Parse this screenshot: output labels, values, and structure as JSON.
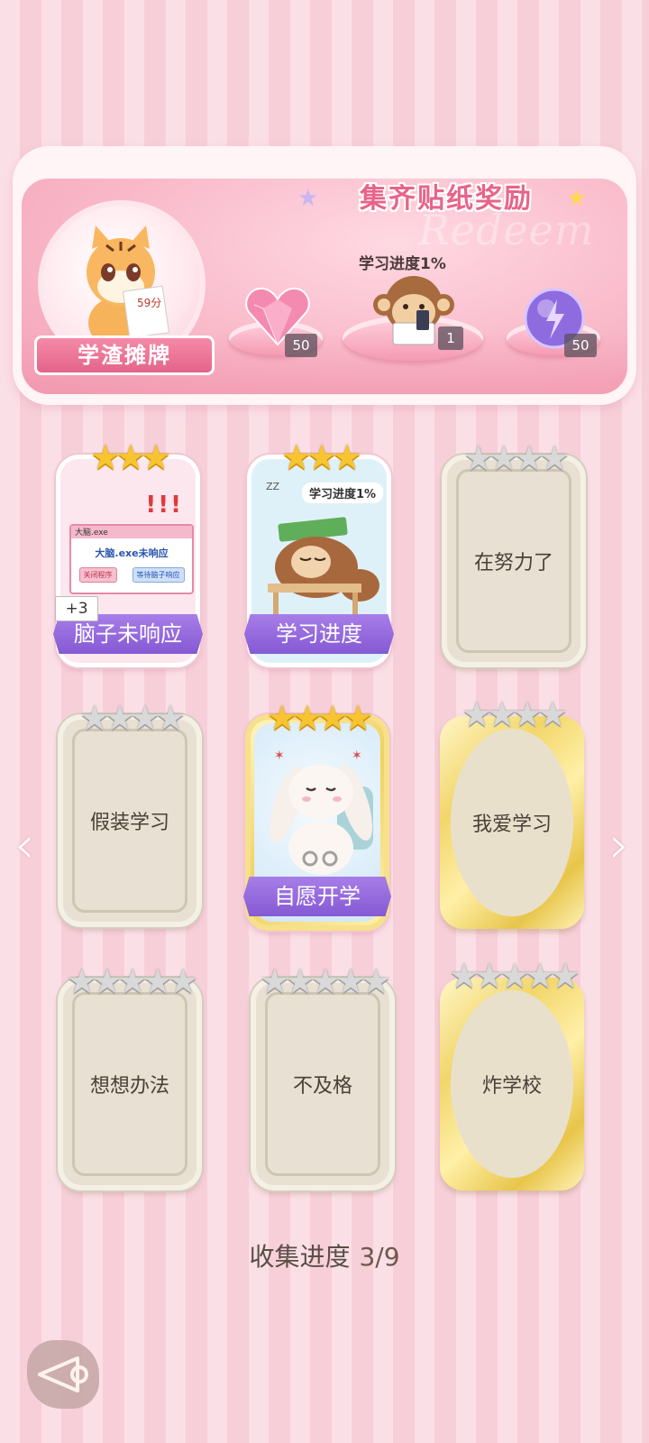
{
  "banner": {
    "title": "集齐贴纸奖励",
    "bg_word": "Redeem",
    "avatar_label": "学渣摊牌",
    "avatar_score": "59分",
    "rewards": [
      {
        "icon": "heart-gem-icon",
        "count": "50"
      },
      {
        "icon": "monkey-sticker-icon",
        "label": "学习进度1%",
        "count": "1"
      },
      {
        "icon": "lightning-orb-icon",
        "count": "50"
      }
    ]
  },
  "cards": [
    {
      "name": "脑子未响应",
      "stars": 3,
      "max_stars": 3,
      "unlocked": true,
      "badge": "+3",
      "art": {
        "window_title": "大脑.exe",
        "message": "大脑.exe未响应",
        "btn1": "关闭程序",
        "btn2": "等待脑子响应"
      }
    },
    {
      "name": "学习进度",
      "stars": 3,
      "max_stars": 3,
      "unlocked": true,
      "art": {
        "caption": "学习进度1%",
        "zz": "ZZ"
      }
    },
    {
      "name": "在努力了",
      "stars": 0,
      "max_stars": 4,
      "unlocked": false
    },
    {
      "name": "假装学习",
      "stars": 0,
      "max_stars": 4,
      "unlocked": false
    },
    {
      "name": "自愿开学",
      "stars": 4,
      "max_stars": 4,
      "unlocked": true
    },
    {
      "name": "我爱学习",
      "stars": 0,
      "max_stars": 4,
      "unlocked": false
    },
    {
      "name": "想想办法",
      "stars": 0,
      "max_stars": 5,
      "unlocked": false
    },
    {
      "name": "不及格",
      "stars": 0,
      "max_stars": 5,
      "unlocked": false
    },
    {
      "name": "炸学校",
      "stars": 0,
      "max_stars": 5,
      "unlocked": false
    }
  ],
  "collect": {
    "label": "收集进度",
    "value": "3/9"
  },
  "nav": {
    "prev": "‹",
    "next": "›"
  }
}
